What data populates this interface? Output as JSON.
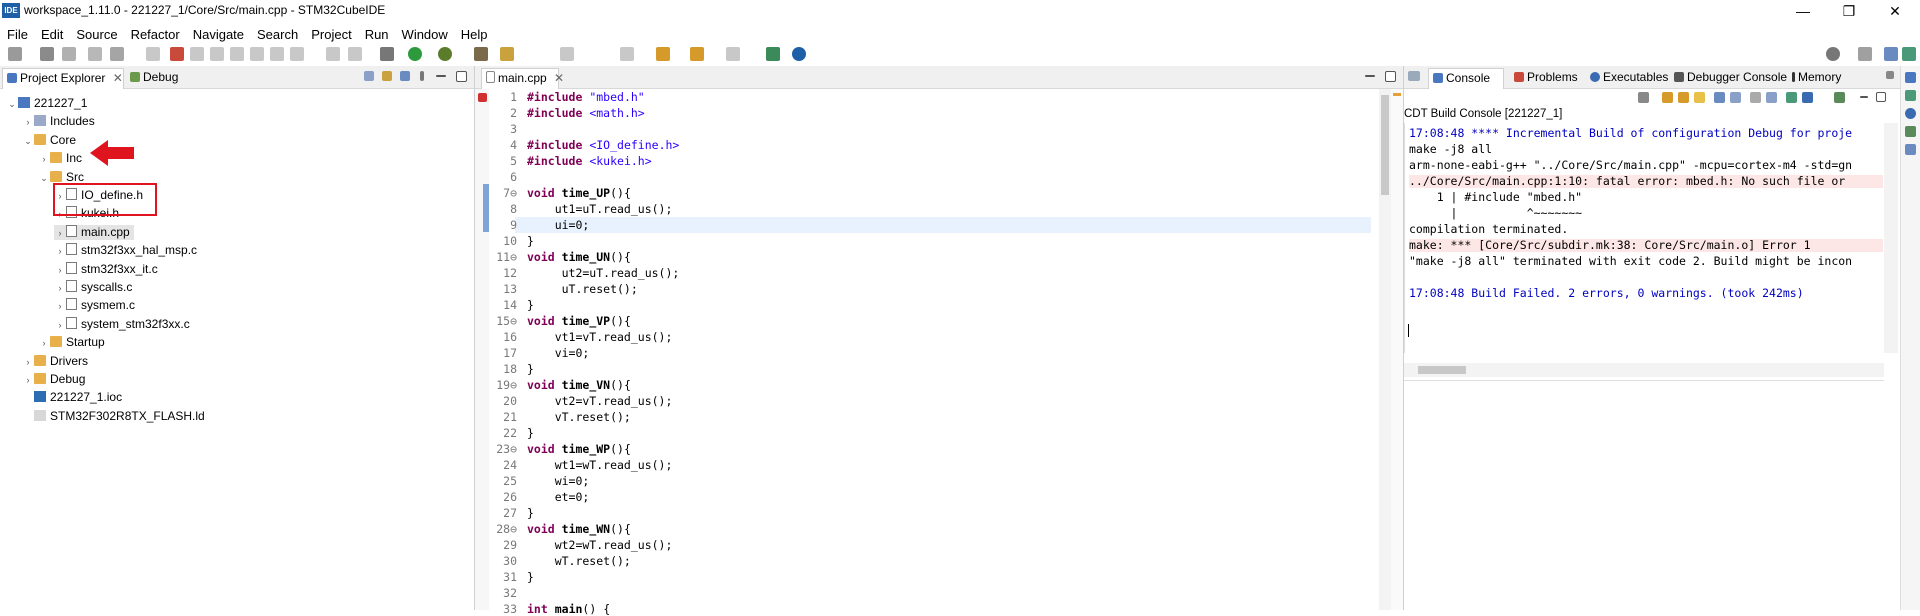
{
  "window": {
    "title": "workspace_1.11.0 - 221227_1/Core/Src/main.cpp - STM32CubeIDE",
    "app_icon_label": "IDE",
    "minimize": "—",
    "restore": "❐",
    "close": "✕"
  },
  "menu": [
    "File",
    "Edit",
    "Source",
    "Refactor",
    "Navigate",
    "Search",
    "Project",
    "Run",
    "Window",
    "Help"
  ],
  "left_panel": {
    "tabs": [
      {
        "label": "Project Explorer",
        "close": "✕"
      },
      {
        "label": "Debug"
      }
    ],
    "tree": [
      {
        "label": "221227_1",
        "twisty": "⌄",
        "icon": "project-icon"
      },
      {
        "label": "Includes",
        "twisty": "›",
        "icon": "includes-icon"
      },
      {
        "label": "Core",
        "twisty": "⌄",
        "icon": "source-folder-icon"
      },
      {
        "label": "Inc",
        "twisty": "›",
        "icon": "folder-icon"
      },
      {
        "label": "Src",
        "twisty": "⌄",
        "icon": "folder-icon"
      },
      {
        "label": "IO_define.h",
        "twisty": "›",
        "icon": "header-file-icon"
      },
      {
        "label": "kukei.h",
        "twisty": "›",
        "icon": "header-file-icon"
      },
      {
        "label": "main.cpp",
        "twisty": "›",
        "icon": "cpp-file-icon"
      },
      {
        "label": "stm32f3xx_hal_msp.c",
        "twisty": "›",
        "icon": "c-file-icon"
      },
      {
        "label": "stm32f3xx_it.c",
        "twisty": "›",
        "icon": "c-file-icon"
      },
      {
        "label": "syscalls.c",
        "twisty": "›",
        "icon": "c-file-icon"
      },
      {
        "label": "sysmem.c",
        "twisty": "›",
        "icon": "c-file-icon"
      },
      {
        "label": "system_stm32f3xx.c",
        "twisty": "›",
        "icon": "c-file-icon"
      },
      {
        "label": "Startup",
        "twisty": "›",
        "icon": "folder-icon"
      },
      {
        "label": "Drivers",
        "twisty": "›",
        "icon": "source-folder-icon"
      },
      {
        "label": "Debug",
        "twisty": "›",
        "icon": "folder-icon"
      },
      {
        "label": "221227_1.ioc",
        "twisty": "",
        "icon": "ioc-file-icon"
      },
      {
        "label": "STM32F302R8TX_FLASH.ld",
        "twisty": "",
        "icon": "ld-file-icon"
      }
    ]
  },
  "editor": {
    "tab_label": "main.cpp",
    "tab_close": "✕",
    "lines": [
      {
        "n": "1",
        "text": "#include \"mbed.h\""
      },
      {
        "n": "2",
        "text": "#include <math.h>"
      },
      {
        "n": "3",
        "text": ""
      },
      {
        "n": "4",
        "text": "#include <IO_define.h>"
      },
      {
        "n": "5",
        "text": "#include <kukei.h>"
      },
      {
        "n": "6",
        "text": ""
      },
      {
        "n": "7⊖",
        "text": "void time_UP(){"
      },
      {
        "n": "8",
        "text": "    ut1=uT.read_us();"
      },
      {
        "n": "9",
        "text": "    ui=0;"
      },
      {
        "n": "10",
        "text": "}"
      },
      {
        "n": "11⊖",
        "text": "void time_UN(){"
      },
      {
        "n": "12",
        "text": "     ut2=uT.read_us();"
      },
      {
        "n": "13",
        "text": "     uT.reset();"
      },
      {
        "n": "14",
        "text": "}"
      },
      {
        "n": "15⊖",
        "text": "void time_VP(){"
      },
      {
        "n": "16",
        "text": "    vt1=vT.read_us();"
      },
      {
        "n": "17",
        "text": "    vi=0;"
      },
      {
        "n": "18",
        "text": "}"
      },
      {
        "n": "19⊖",
        "text": "void time_VN(){"
      },
      {
        "n": "20",
        "text": "    vt2=vT.read_us();"
      },
      {
        "n": "21",
        "text": "    vT.reset();"
      },
      {
        "n": "22",
        "text": "}"
      },
      {
        "n": "23⊖",
        "text": "void time_WP(){"
      },
      {
        "n": "24",
        "text": "    wt1=wT.read_us();"
      },
      {
        "n": "25",
        "text": "    wi=0;"
      },
      {
        "n": "26",
        "text": "    et=0;"
      },
      {
        "n": "27",
        "text": "}"
      },
      {
        "n": "28⊖",
        "text": "void time_WN(){"
      },
      {
        "n": "29",
        "text": "    wt2=wT.read_us();"
      },
      {
        "n": "30",
        "text": "    wT.reset();"
      },
      {
        "n": "31",
        "text": "}"
      },
      {
        "n": "32",
        "text": ""
      },
      {
        "n": "33",
        "text": "int main() {"
      }
    ]
  },
  "console": {
    "tabs": [
      "Console",
      "Problems",
      "Executables",
      "Debugger Console",
      "Memory"
    ],
    "title": "CDT Build Console [221227_1]",
    "lines": [
      "17:08:48 **** Incremental Build of configuration Debug for proje",
      "make -j8 all",
      "arm-none-eabi-g++ \"../Core/Src/main.cpp\" -mcpu=cortex-m4 -std=gn",
      "../Core/Src/main.cpp:1:10: fatal error: mbed.h: No such file or",
      "    1 | #include \"mbed.h\"",
      "      |          ^~~~~~~~",
      "compilation terminated.",
      "make: *** [Core/Src/subdir.mk:38: Core/Src/main.o] Error 1",
      "\"make -j8 all\" terminated with exit code 2. Build might be incon",
      "",
      "17:08:48 Build Failed. 2 errors, 0 warnings. (took 242ms)"
    ]
  },
  "colors": {
    "annotation_red": "#e0141e",
    "keyword": "#7f0055",
    "string": "#2a00ff",
    "console_blue": "#0000c0"
  }
}
